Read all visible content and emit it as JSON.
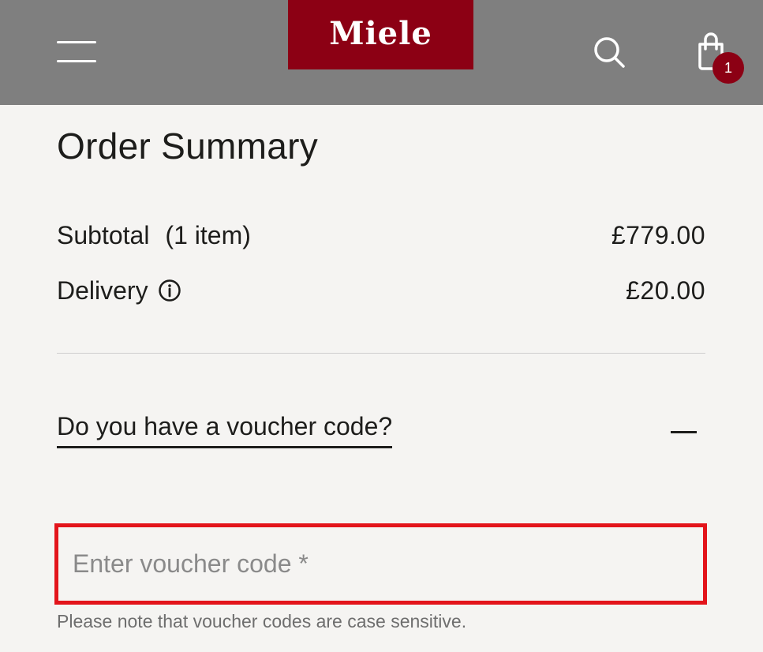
{
  "header": {
    "brand": "Miele",
    "cart_count": "1",
    "colors": {
      "header_bg": "#7f7f7f",
      "brand_red": "#8c0014",
      "error_red": "#e3141b"
    },
    "icons": [
      "menu-icon",
      "search-icon",
      "shopping-bag-icon"
    ]
  },
  "summary": {
    "title": "Order Summary",
    "subtotal_label": "Subtotal",
    "subtotal_count": "(1 item)",
    "subtotal_value": "£779.00",
    "delivery_label": "Delivery",
    "delivery_value": "£20.00"
  },
  "voucher": {
    "question": "Do you have a voucher code?",
    "input_placeholder": "Enter voucher code *",
    "input_value": "",
    "note": "Please note that voucher codes are case sensitive."
  }
}
